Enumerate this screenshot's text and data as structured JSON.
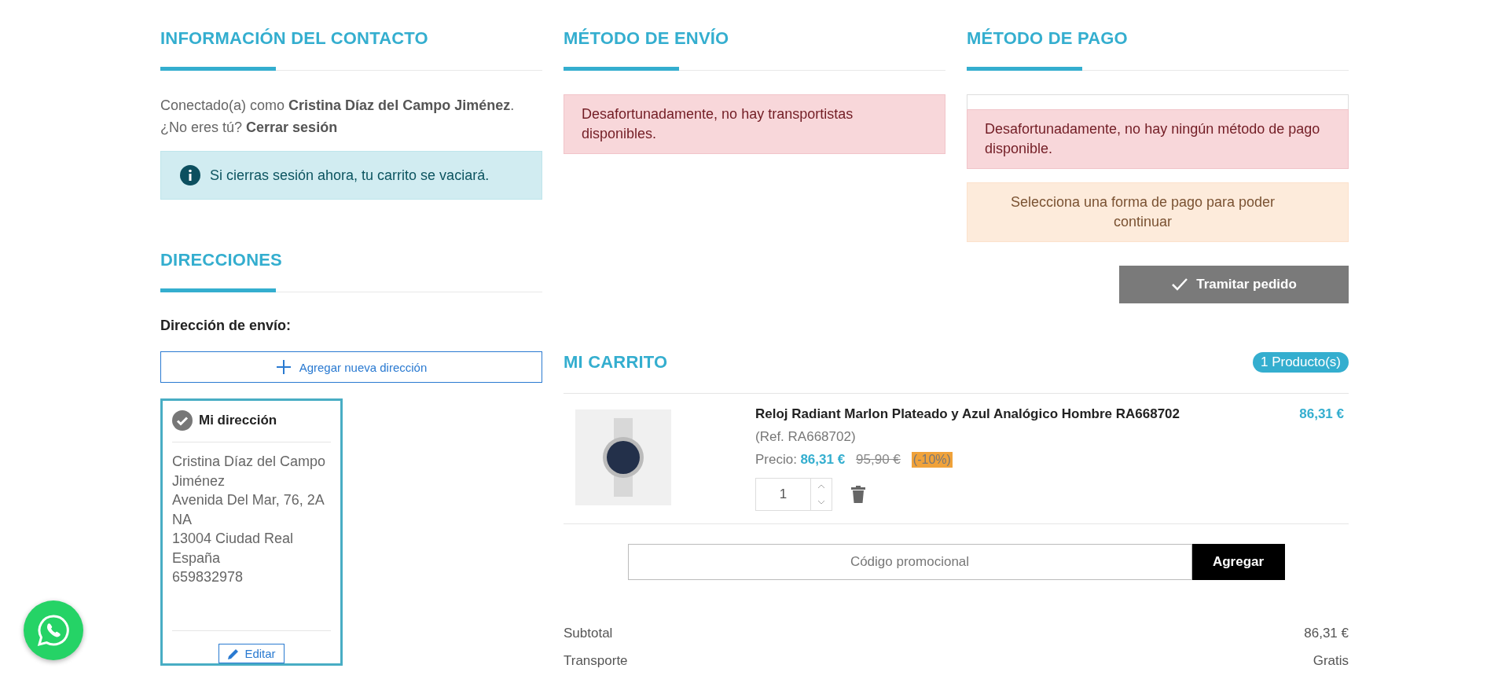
{
  "contact": {
    "title": "INFORMACIÓN DEL CONTACTO",
    "text": "Conectado(a) como **Cristina Díaz del Campo Jiménez**.",
    "question": "¿No eres tú?",
    "logout_link": "Cerrar sesión",
    "info": "Si cierras sesión ahora, tu carrito se vaciará."
  },
  "addresses": {
    "title": "DIRECCIONES",
    "shipping_label": "Dirección de envío:",
    "add_button": "Agregar nueva dirección",
    "cards": [
      {
        "title": "Mi dirección",
        "selected": true,
        "lines": [
          "Cristina Díaz del Campo Jiménez",
          "Avenida Del Mar, 76, 2A",
          "NA",
          "13004 Ciudad Real",
          "España",
          "659832978"
        ],
        "edit": "Editar"
      }
    ]
  },
  "shipping": {
    "title": "MÉTODO DE ENVÍO",
    "alert": "Desafortunadamente, no hay transportistas disponibles."
  },
  "payment": {
    "title": "MÉTODO DE PAGO",
    "alert": "Desafortunadamente, no hay ningún método de pago disponible.",
    "warning": "Selecciona una forma de pago para poder continuar",
    "submit": "Tramitar pedido",
    "submit_disabled": true
  },
  "cart": {
    "title": "MI CARRITO",
    "count_badge": "1 Producto(s)",
    "items": [
      {
        "name": "Reloj Radiant Marlon Plateado y Azul Analógico Hombre RA668702",
        "ref": "(Ref. RA668702)",
        "price_label": "Precio:",
        "price": "86,31 €",
        "old_price": "95,90 €",
        "discount": "(-10%)",
        "quantity": "1",
        "total": "86,31 €"
      }
    ],
    "promo": {
      "placeholder": "Código promocional",
      "button": "Agregar"
    },
    "summary": [
      {
        "label": "Subtotal",
        "value": "86,31 €"
      },
      {
        "label": "Transporte",
        "value": "Gratis"
      }
    ]
  }
}
